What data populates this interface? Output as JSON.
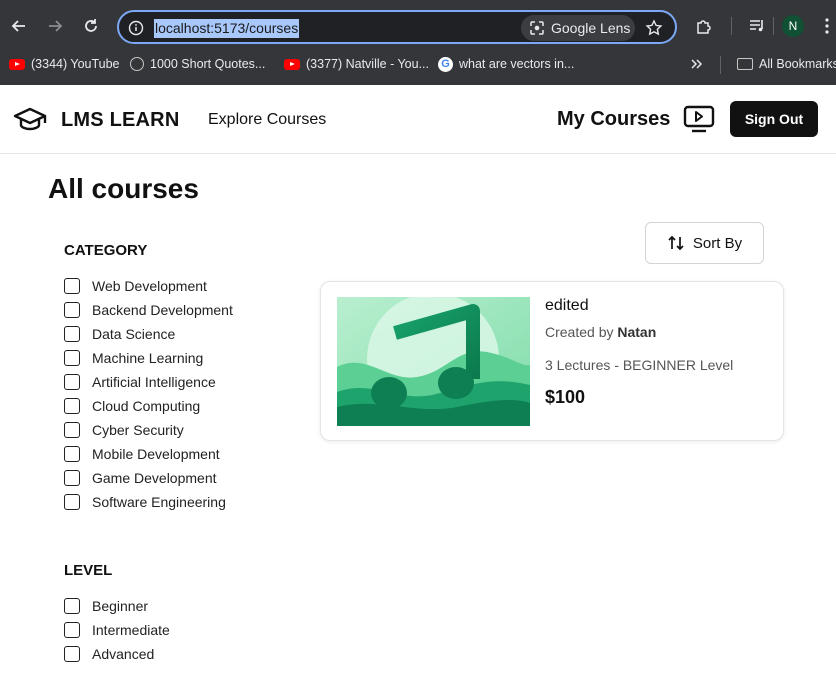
{
  "browser": {
    "url": "localhost:5173/courses",
    "lens_label": "Google Lens",
    "avatar_letter": "N",
    "bookmarks": [
      {
        "label": "(3344) YouTube",
        "icon": "youtube-icon"
      },
      {
        "label": "1000 Short Quotes...",
        "icon": "globe-icon"
      },
      {
        "label": "(3377) Natville - You...",
        "icon": "youtube-icon"
      },
      {
        "label": "what are vectors in...",
        "icon": "google-icon"
      }
    ],
    "all_bookmarks_label": "All Bookmarks"
  },
  "header": {
    "brand": "LMS LEARN",
    "explore_label": "Explore Courses",
    "my_courses_label": "My Courses",
    "sign_out_label": "Sign Out"
  },
  "page": {
    "title": "All courses",
    "sort_label": "Sort By"
  },
  "filters": {
    "category_heading": "CATEGORY",
    "categories": [
      "Web Development",
      "Backend Development",
      "Data Science",
      "Machine Learning",
      "Artificial Intelligence",
      "Cloud Computing",
      "Cyber Security",
      "Mobile Development",
      "Game Development",
      "Software Engineering"
    ],
    "level_heading": "LEVEL",
    "levels": [
      "Beginner",
      "Intermediate",
      "Advanced"
    ]
  },
  "courses": [
    {
      "title": "edited",
      "created_prefix": "Created by ",
      "author": "Natan",
      "lectures": "3 Lectures - BEGINNER Level",
      "price": "$100"
    }
  ]
}
